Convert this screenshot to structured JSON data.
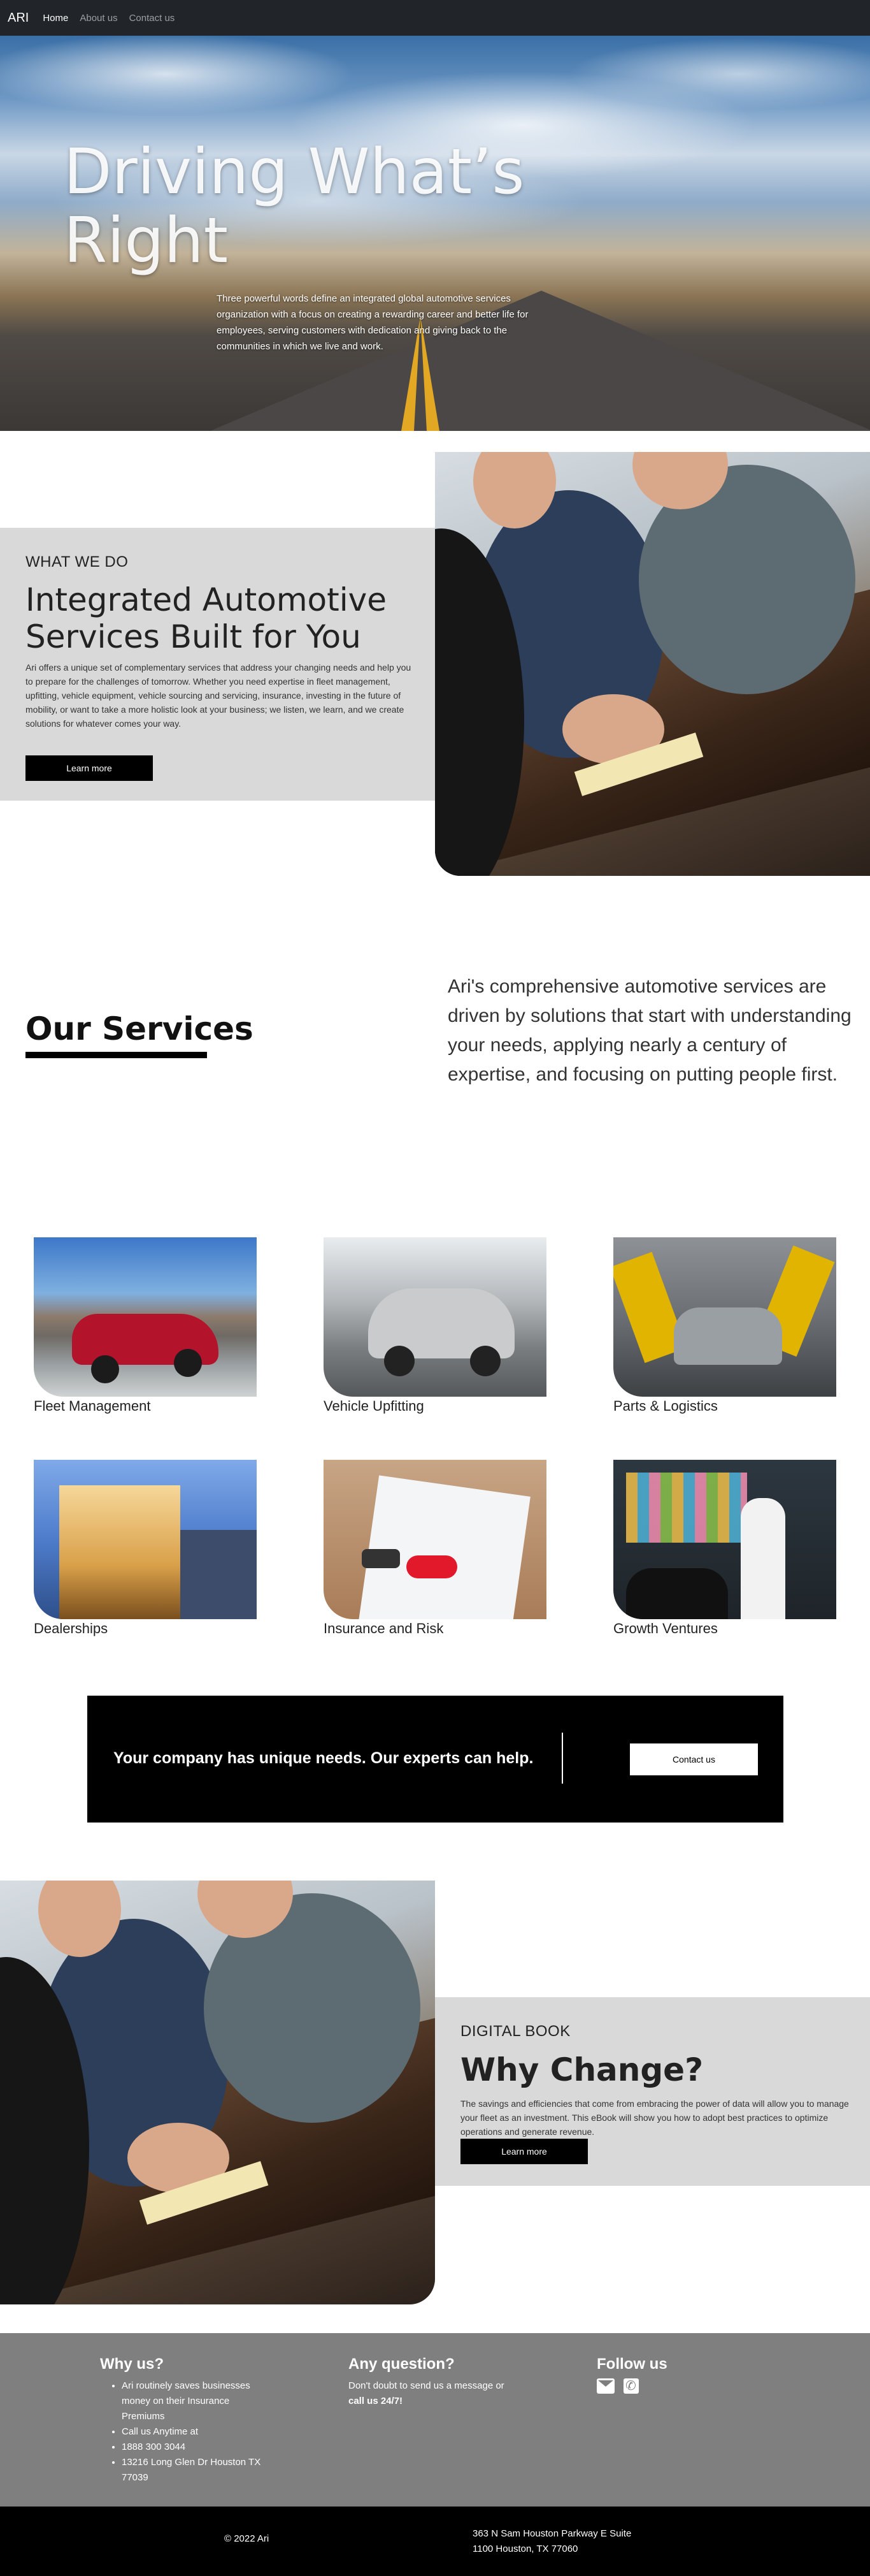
{
  "nav": {
    "brand": "ARI",
    "links": [
      "Home",
      "About us",
      "Contact us"
    ]
  },
  "hero": {
    "title": "Driving What’s Right",
    "subtitle": "Three powerful words define an integrated global automotive services organization with a focus on creating a rewarding career and better life for employees, serving customers with dedication and giving back to the communities in which we live and work."
  },
  "what_we_do": {
    "eyebrow": "WHAT WE DO",
    "title": "Integrated Automotive Services Built for You",
    "body": "Ari offers a unique set of complementary services that address your changing needs and help you to prepare for the challenges of tomorrow. Whether you need expertise in fleet management, upfitting, vehicle equipment, vehicle sourcing and servicing, insurance, investing in the future of mobility, or want to take a more holistic look at your business; we listen, we learn, and we create solutions for whatever comes your way.",
    "button": "Learn more"
  },
  "services": {
    "title": "Our Services",
    "intro": "Ari's comprehensive automotive services are driven by solutions that start with understanding your needs, applying nearly a century of expertise, and focusing on putting people first.",
    "items": [
      {
        "label": "Fleet Management"
      },
      {
        "label": "Vehicle Upfitting"
      },
      {
        "label": "Parts & Logistics"
      },
      {
        "label": "Dealerships"
      },
      {
        "label": "Insurance and Risk"
      },
      {
        "label": "Growth Ventures"
      }
    ]
  },
  "cta": {
    "text": "Your company has unique needs. Our experts can help.",
    "button": "Contact us"
  },
  "digital_book": {
    "eyebrow": "DIGITAL BOOK",
    "title": "Why Change?",
    "body": "The savings and efficiencies that come from embracing the power of data will allow you to manage your fleet as an investment. This eBook will show you how to adopt best practices to optimize operations and generate revenue.",
    "button": "Learn more"
  },
  "footer": {
    "why_us": {
      "title": "Why us?",
      "items": [
        "Ari routinely saves businesses money on their Insurance Premiums",
        "Call us Anytime at",
        "1888 300 3044",
        "13216 Long Glen Dr Houston TX 77039"
      ]
    },
    "question": {
      "title": "Any question?",
      "text": "Don't doubt to send us a message or",
      "strong": "call us 24/7!"
    },
    "follow": {
      "title": "Follow us",
      "icons": [
        "mail-icon",
        "phone-icon"
      ]
    },
    "copyright": "© 2022 Ari",
    "address_line1": "363 N Sam Houston Parkway E Suite",
    "address_line2": "1100 Houston, TX 77060"
  }
}
